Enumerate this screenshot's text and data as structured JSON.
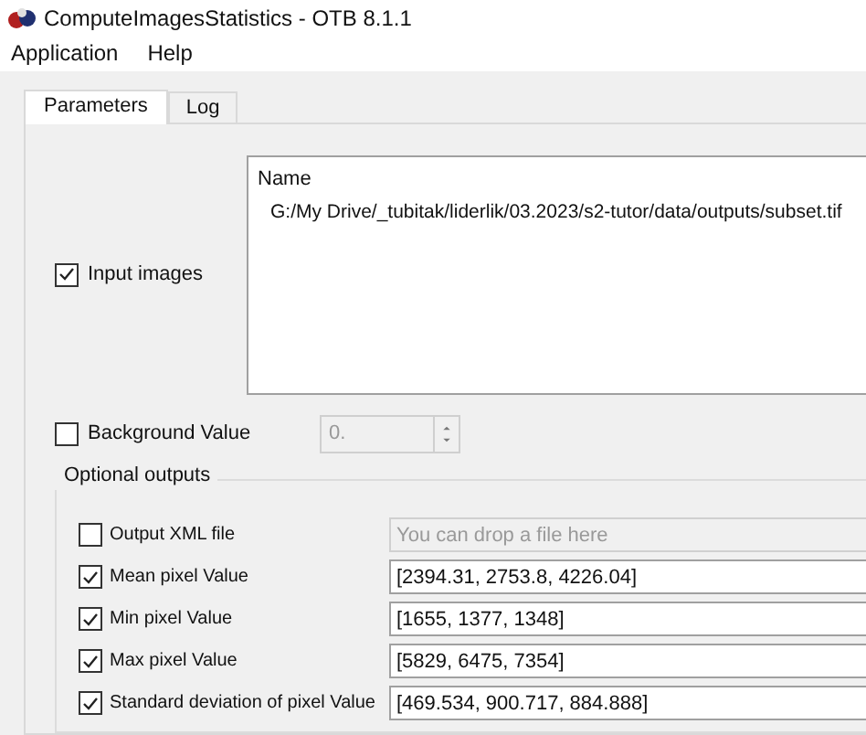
{
  "window": {
    "title": "ComputeImagesStatistics - OTB 8.1.1"
  },
  "menu": [
    "Application",
    "Help"
  ],
  "tabs": [
    {
      "label": "Parameters",
      "selected": true
    },
    {
      "label": "Log",
      "selected": false
    }
  ],
  "input_images": {
    "label": "Input images",
    "checked": true,
    "list_header": "Name",
    "files": [
      "G:/My Drive/_tubitak/liderlik/03.2023/s2-tutor/data/outputs/subset.tif"
    ]
  },
  "background_value": {
    "label": "Background Value",
    "checked": false,
    "value": "0."
  },
  "optional_outputs": {
    "title": "Optional outputs",
    "items": [
      {
        "kind": "file",
        "label": "Output XML file",
        "checked": false,
        "placeholder": "You can drop a file here"
      },
      {
        "kind": "value",
        "label": "Mean pixel Value",
        "checked": true,
        "value": "[2394.31, 2753.8, 4226.04]"
      },
      {
        "kind": "value",
        "label": "Min pixel Value",
        "checked": true,
        "value": "[1655, 1377, 1348]"
      },
      {
        "kind": "value",
        "label": "Max pixel Value",
        "checked": true,
        "value": "[5829, 6475, 7354]"
      },
      {
        "kind": "value",
        "label": "Standard deviation of pixel Value",
        "checked": true,
        "value": "[469.534, 900.717, 884.888]"
      }
    ]
  }
}
